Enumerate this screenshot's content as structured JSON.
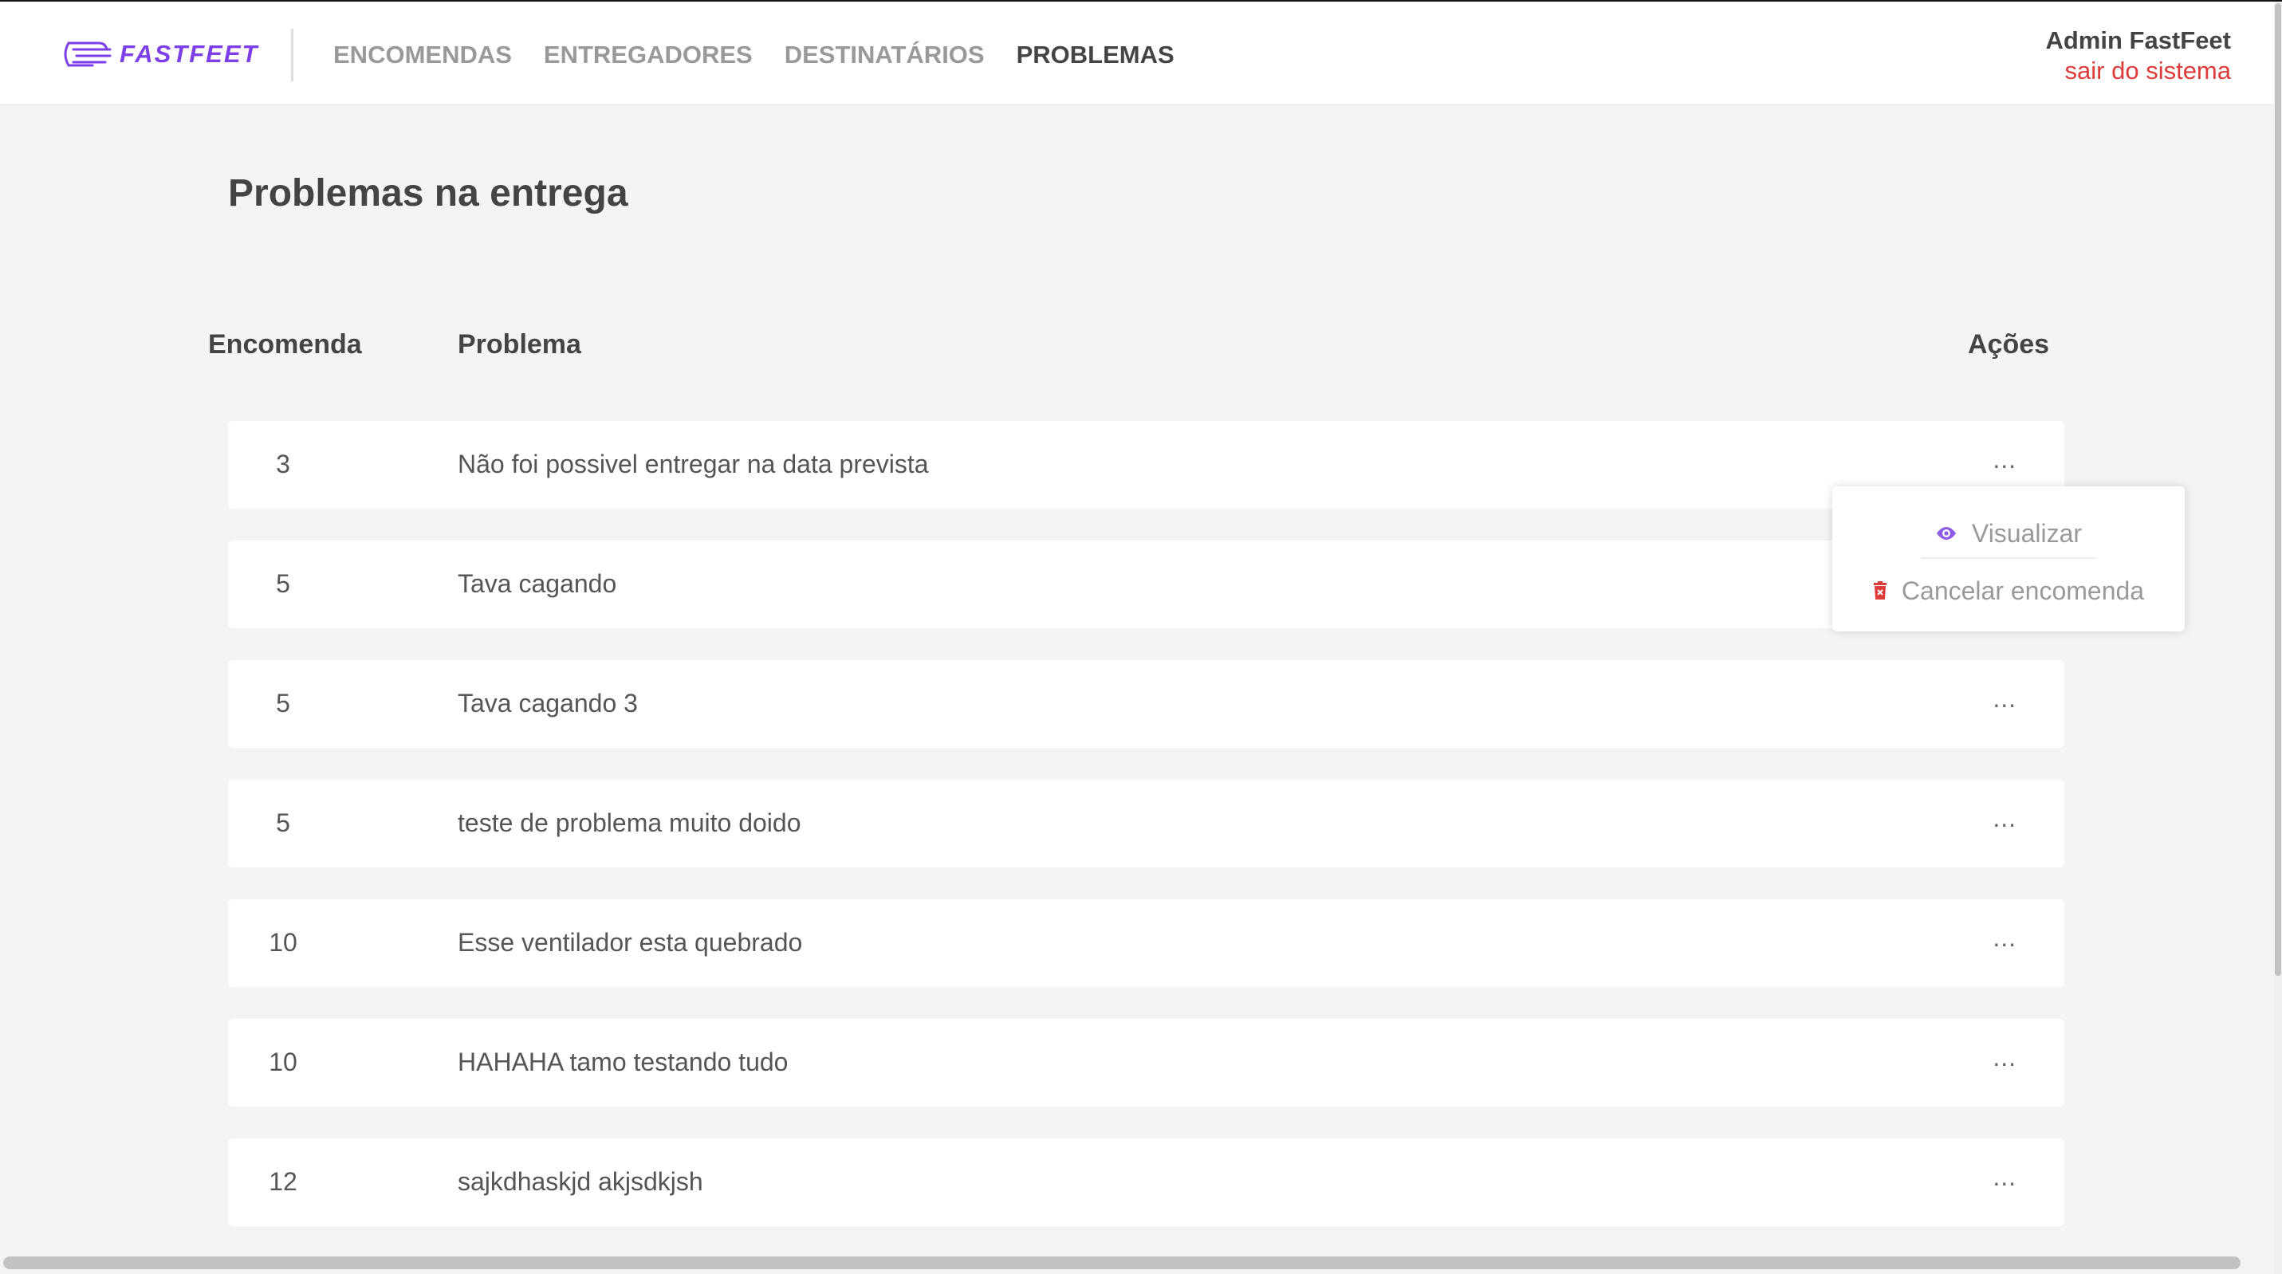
{
  "brand": {
    "name": "FASTFEET",
    "accent": "#7d40e7"
  },
  "nav": {
    "items": [
      {
        "label": "ENCOMENDAS"
      },
      {
        "label": "ENTREGADORES"
      },
      {
        "label": "DESTINATÁRIOS"
      },
      {
        "label": "PROBLEMAS"
      }
    ],
    "active": "PROBLEMAS"
  },
  "user": {
    "name": "Admin FastFeet",
    "logout": "sair do sistema",
    "logout_color": "#de3b3b"
  },
  "page": {
    "title": "Problemas na entrega"
  },
  "table": {
    "headers": {
      "order": "Encomenda",
      "problem": "Problema",
      "actions": "Ações"
    },
    "rows": [
      {
        "order": "3",
        "problem": "Não foi possivel entregar na data prevista",
        "actions": "..."
      },
      {
        "order": "5",
        "problem": "Tava cagando",
        "actions": "..."
      },
      {
        "order": "5",
        "problem": "Tava cagando 3",
        "actions": "..."
      },
      {
        "order": "5",
        "problem": "teste de problema muito doido",
        "actions": "..."
      },
      {
        "order": "10",
        "problem": "Esse ventilador esta quebrado",
        "actions": "..."
      },
      {
        "order": "10",
        "problem": "HAHAHA tamo testando tudo",
        "actions": "..."
      },
      {
        "order": "12",
        "problem": "sajkdhaskjd akjsdkjsh",
        "actions": "..."
      }
    ]
  },
  "popover": {
    "view": {
      "label": "Visualizar",
      "icon": "eye-icon",
      "color": "#8e5be8"
    },
    "cancel": {
      "label": "Cancelar encomenda",
      "icon": "trash-icon",
      "color": "#de3b3b"
    }
  }
}
